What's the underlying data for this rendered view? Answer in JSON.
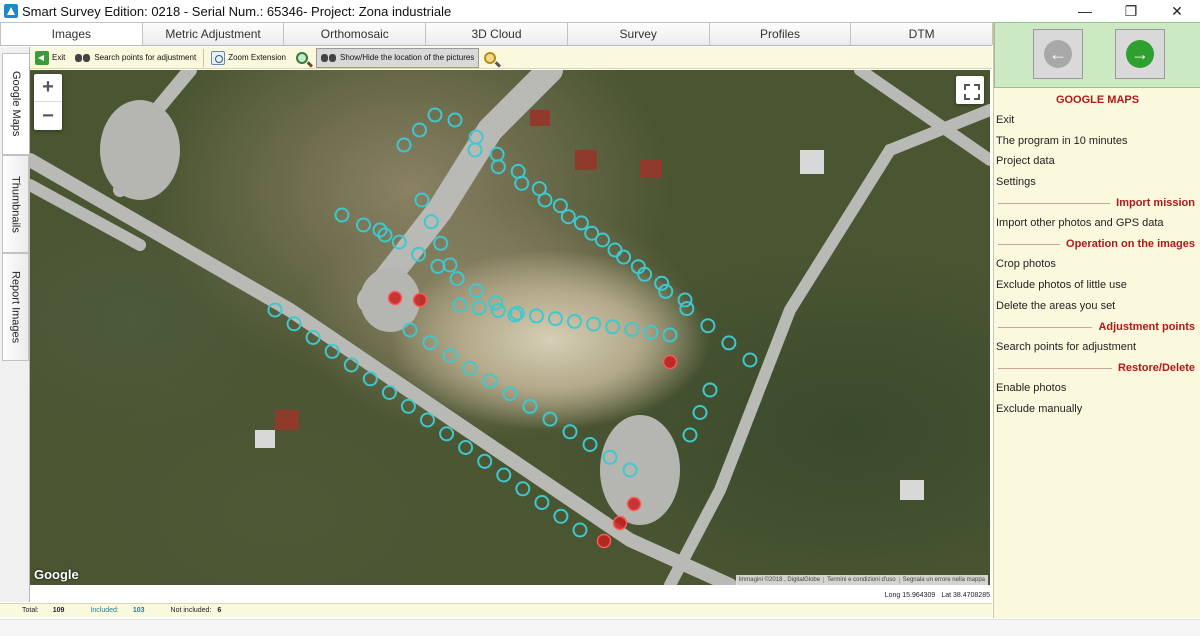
{
  "window": {
    "title": "Smart Survey  Edition: 0218 - Serial Num.: 65346- Project: Zona industriale",
    "minimize": "—",
    "restore": "❐",
    "close": "✕"
  },
  "tabs": [
    {
      "label": "Images",
      "active": true
    },
    {
      "label": "Metric Adjustment"
    },
    {
      "label": "Orthomosaic"
    },
    {
      "label": "3D Cloud"
    },
    {
      "label": "Survey"
    },
    {
      "label": "Profiles"
    },
    {
      "label": "DTM"
    }
  ],
  "toolbar": {
    "exit": "Exit",
    "search_points": "Search points for adjustment",
    "zoom_extension": "Zoom Extension",
    "show_hide_pictures": "Show/Hide the location of the pictures"
  },
  "side_tabs": [
    "Google Maps",
    "Thumbnails",
    "Report Images"
  ],
  "map": {
    "zoom_in": "+",
    "zoom_out": "−",
    "logo": "Google",
    "attribution": [
      "Immagini ©2018 , DigitalGlobe",
      "Termini e condizioni d'uso",
      "Segnala un errore nella mappa"
    ],
    "colors": {
      "included": "#3ec8d0",
      "excluded": "#c81e1e"
    }
  },
  "coords": {
    "long": "Long 15.964309",
    "lat": "Lat 38.4708285"
  },
  "status": {
    "total_label": "Total:",
    "total_value": "109",
    "included_label": "Included:",
    "included_value": "103",
    "not_included_label": "Not included:",
    "not_included_value": "6"
  },
  "panel": {
    "heading": "GOOGLE MAPS",
    "items_top": [
      "Exit",
      "The program in 10 minutes",
      "Project data",
      "Settings"
    ],
    "import_mission": {
      "title": "Import mission",
      "items": [
        "Import other photos and GPS data"
      ]
    },
    "operation": {
      "title": "Operation on the images",
      "items": [
        "Crop photos",
        "Exclude photos of little use",
        "Delete the areas you set"
      ]
    },
    "adjustment": {
      "title": "Adjustment points",
      "items": [
        "Search points for adjustment"
      ]
    },
    "restore": {
      "title": "Restore/Delete",
      "items": [
        "Enable photos",
        "Exclude manually"
      ]
    }
  }
}
